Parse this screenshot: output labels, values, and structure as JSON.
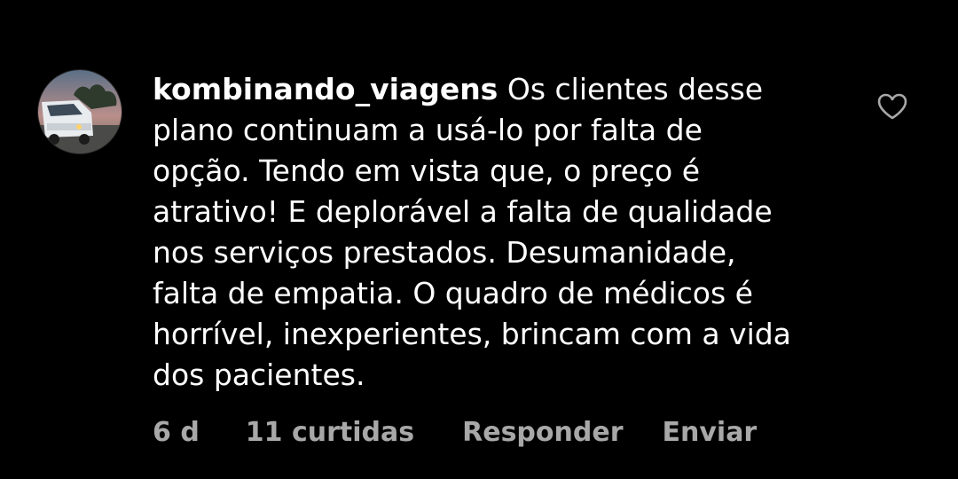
{
  "comment": {
    "username": "kombinando_viagens",
    "text": "Os clientes desse plano continuam a usá-lo por falta de opção. Tendo em vista que, o preço é atrativo! E deplorável a falta de qualidade nos serviços prestados. Desumanidade, falta de empatia. O quadro de médicos é horrível, inexperientes, brincam com a vida dos pacientes.",
    "lines": [
      "Os clientes desse",
      "plano continuam a usá-lo por falta de",
      "opção. Tendo em vista que, o preço é",
      "atrativo! E deplorável a falta de qualidade",
      "nos serviços prestados. Desumanidade,",
      "falta de empatia. O quadro de médicos é",
      "horrível, inexperientes, brincam com a vida",
      "dos pacientes."
    ],
    "avatar_icon": "avatar-van-photo",
    "like_icon": "heart-outline-icon"
  },
  "actions": {
    "timestamp": "6 d",
    "likes": "11 curtidas",
    "reply_label": "Responder",
    "send_label": "Enviar"
  },
  "colors": {
    "background": "#000000",
    "text": "#ffffff",
    "secondary": "#a8a8a8"
  }
}
